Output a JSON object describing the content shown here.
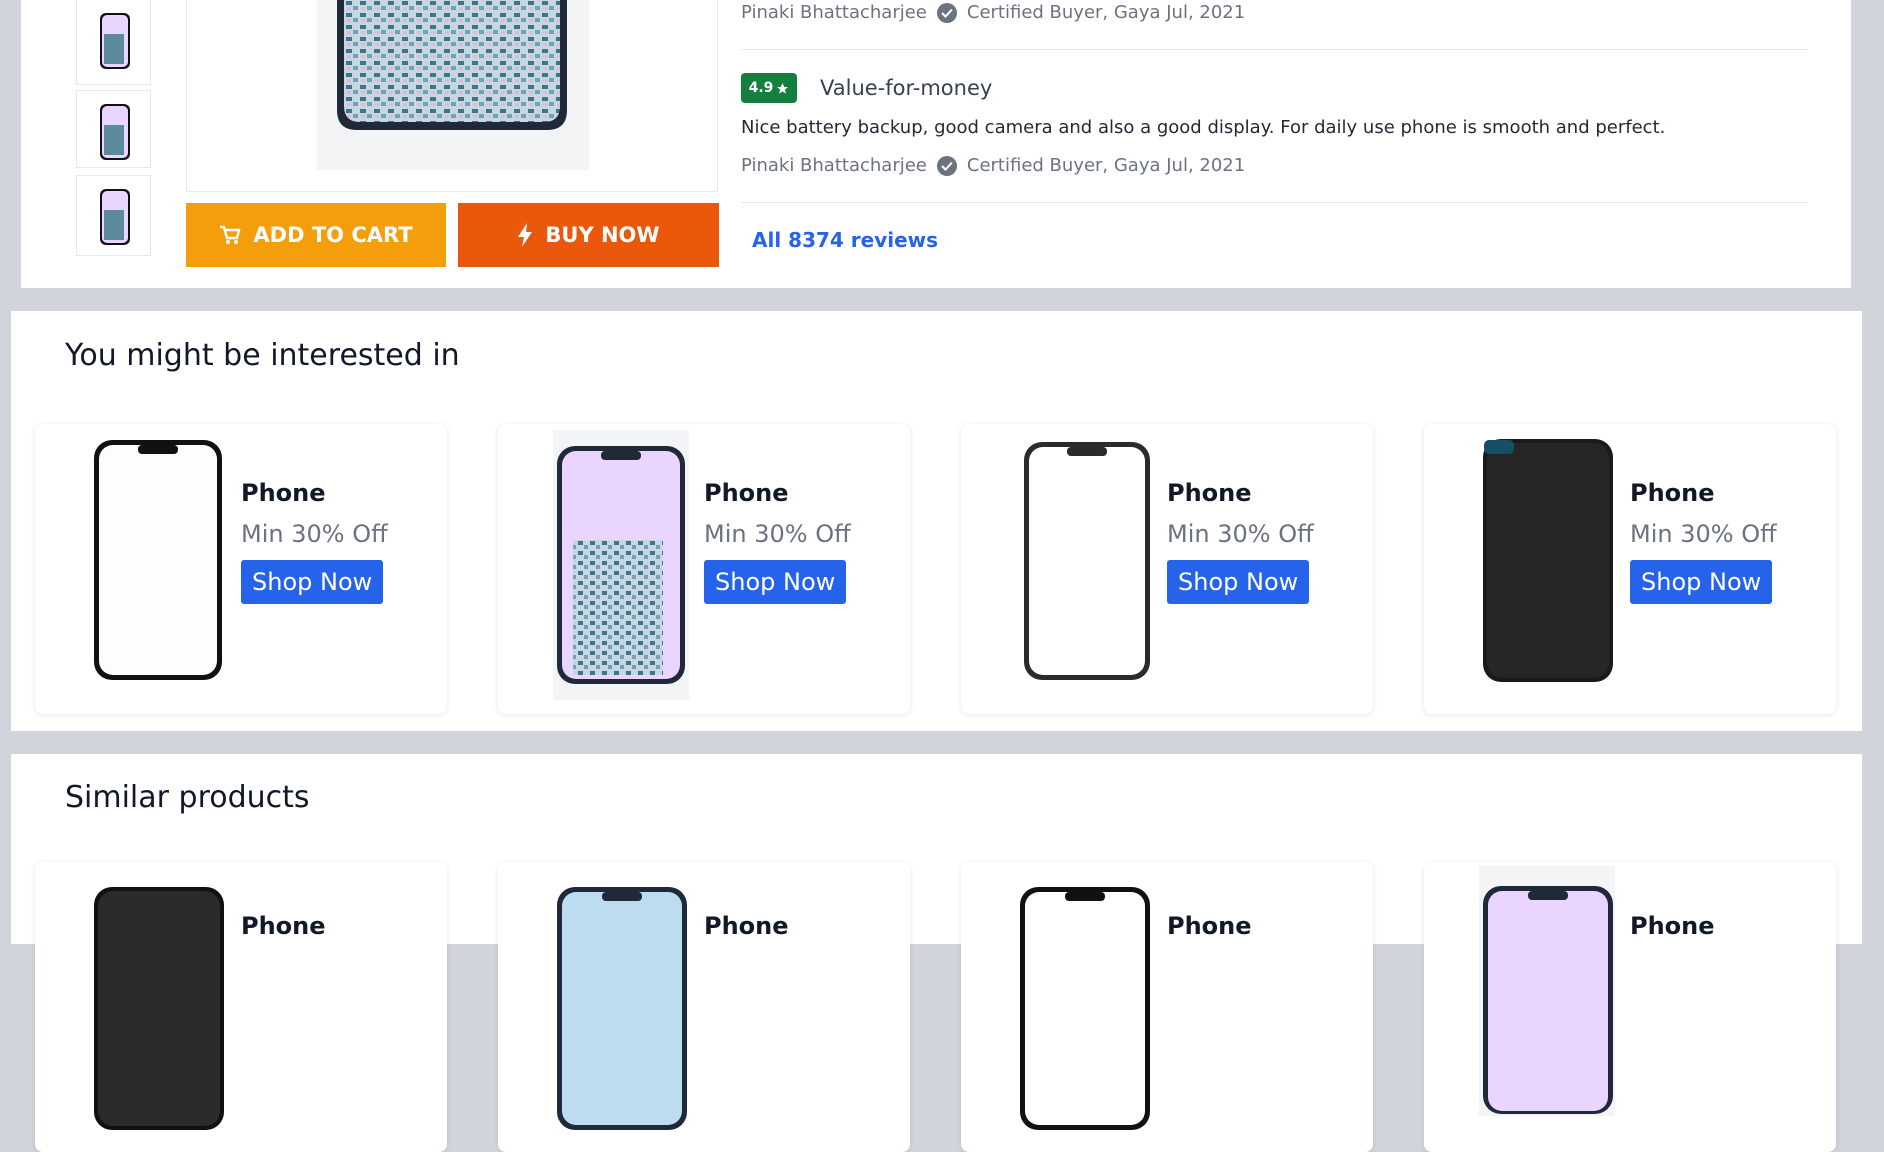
{
  "product": {
    "add_to_cart_label": "ADD TO CART",
    "buy_now_label": "BUY NOW",
    "add_to_cart_color": "#f59e0b",
    "buy_now_color": "#ea580c"
  },
  "reviews": {
    "first_reviewer": "Pinaki Bhattacharjee",
    "first_meta": "Certified Buyer, Gaya Jul, 2021",
    "rating": "4.9",
    "title": "Value-for-money",
    "text": "Nice battery backup, good camera and also a good display. For daily use phone is smooth and perfect.",
    "second_reviewer": "Pinaki Bhattacharjee",
    "second_meta": "Certified Buyer, Gaya Jul, 2021",
    "all_reviews_label": "All 8374 reviews",
    "rating_color": "#15803d"
  },
  "interest": {
    "title": "You might be interested in",
    "cards": [
      {
        "name": "Phone",
        "offer": "Min 30% Off",
        "button": "Shop Now",
        "screen": "white"
      },
      {
        "name": "Phone",
        "offer": "Min 30% Off",
        "button": "Shop Now",
        "screen": "building"
      },
      {
        "name": "Phone",
        "offer": "Min 30% Off",
        "button": "Shop Now",
        "screen": "white"
      },
      {
        "name": "Phone",
        "offer": "Min 30% Off",
        "button": "Shop Now",
        "screen": "black"
      }
    ]
  },
  "similar": {
    "title": "Similar products",
    "cards": [
      {
        "name": "Phone",
        "screen": "black"
      },
      {
        "name": "Phone",
        "screen": "blue"
      },
      {
        "name": "Phone",
        "screen": "white"
      },
      {
        "name": "Phone",
        "screen": "building"
      }
    ]
  },
  "colors": {
    "accent_blue": "#2563eb",
    "page_bg": "#d1d5db"
  }
}
